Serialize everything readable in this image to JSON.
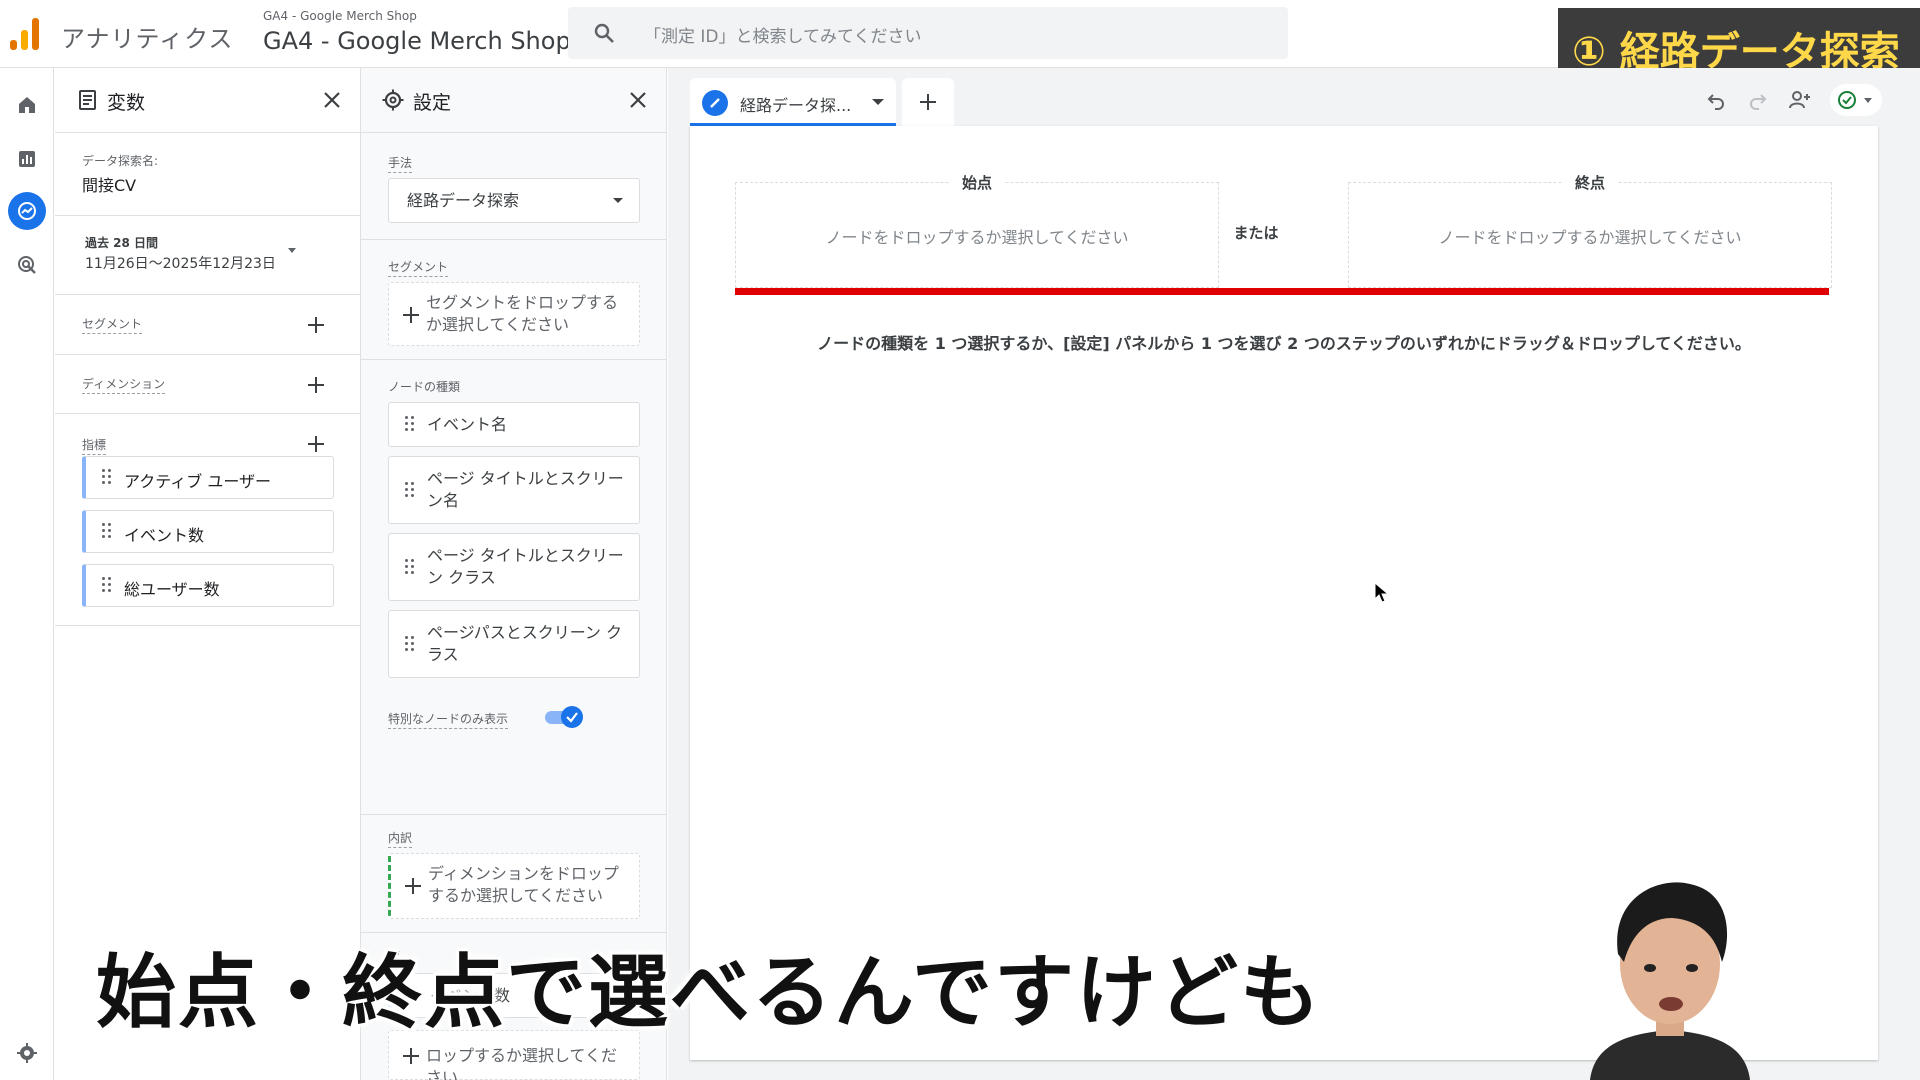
{
  "topbar": {
    "app_name": "アナリティクス",
    "property_account": "GA4 - Google Merch Shop",
    "property_name": "GA4 - Google Merch Shop",
    "search_placeholder": "「測定 ID」と検索してみてください",
    "badge": "① 経路データ探索"
  },
  "rail": {
    "items": [
      "home-icon",
      "reports-icon",
      "explore-icon",
      "advertising-icon"
    ],
    "settings": "gear-icon"
  },
  "variables_panel": {
    "title": "変数",
    "exploration_name_label": "データ探索名:",
    "exploration_name": "間接CV",
    "date_range_label": "過去 28 日間",
    "date_range": "11月26日～2025年12月23日",
    "segments_label": "セグメント",
    "dimensions_label": "ディメンション",
    "metrics_label": "指標",
    "metrics": [
      "アクティブ ユーザー",
      "イベント数",
      "総ユーザー数"
    ]
  },
  "settings_panel": {
    "title": "設定",
    "technique_label": "手法",
    "technique_value": "経路データ探索",
    "segment_label": "セグメント",
    "segment_drop": "セグメントをドロップするか選択してください",
    "node_type_label": "ノードの種類",
    "node_types": [
      "イベント名",
      "ページ タイトルとスクリーン名",
      "ページ タイトルとスクリーン クラス",
      "ページパスとスクリーン クラス"
    ],
    "special_nodes_label": "特別なノードのみ表示",
    "special_nodes_on": true,
    "breakdown_label": "内訳",
    "breakdown_drop": "ディメンションをドロップするか選択してください",
    "values_label": "値",
    "values_item": "イベント数",
    "filter_drop": "ロップするか選択してください"
  },
  "canvas": {
    "tab_label": "経路データ探...",
    "start_label": "始点",
    "end_label": "終点",
    "or_label": "または",
    "drop_hint": "ノードをドロップするか選択してください",
    "instruction": "ノードの種類を 1 つ選択するか、[設定] パネルから 1 つを選び 2 つのステップのいずれかにドラッグ＆ドロップしてください。"
  },
  "subtitle": "始点・終点で選べるんですけども",
  "colors": {
    "accent": "#1a73e8",
    "red_line": "#e00000",
    "badge_bg": "#3c3c3c",
    "badge_text": "#ffd84a",
    "metric_chip_border": "#8ab4f8"
  }
}
